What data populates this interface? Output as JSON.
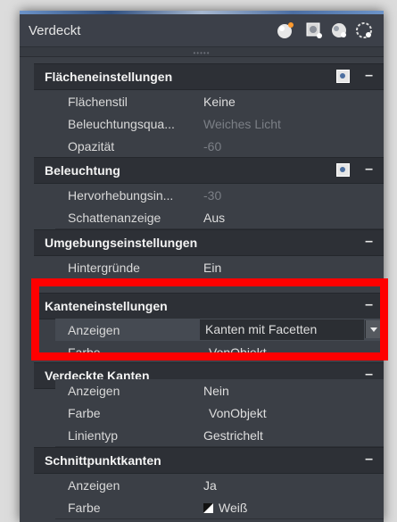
{
  "panel": {
    "title": "Verdeckt"
  },
  "toolbar_icons": [
    "sphere-render-icon",
    "materials-icon",
    "drop-icon",
    "refresh-icon"
  ],
  "sections": {
    "flaechen": {
      "title": "Flächeneinstellungen",
      "collapse": "–",
      "rows": [
        {
          "label": "Flächenstil",
          "value": "Keine"
        },
        {
          "label": "Beleuchtungsqua...",
          "value": "Weiches Licht"
        },
        {
          "label": "Opazität",
          "value": "-60"
        }
      ]
    },
    "beleuchtung": {
      "title": "Beleuchtung",
      "collapse": "–",
      "rows": [
        {
          "label": "Hervorhebungsin...",
          "value": "-30"
        },
        {
          "label": "Schattenanzeige",
          "value": "Aus"
        }
      ]
    },
    "umgebung": {
      "title": "Umgebungseinstellungen",
      "collapse": "–",
      "rows": [
        {
          "label": "Hintergründe",
          "value": "Ein"
        }
      ]
    },
    "kanten": {
      "title": "Kanteneinstellungen",
      "collapse": "–",
      "rows": [
        {
          "label": "Anzeigen",
          "value": "Kanten mit Facetten"
        },
        {
          "label": "Farbe",
          "value": "VonObjekt"
        }
      ]
    },
    "verdeckt": {
      "title": "Verdeckte Kanten",
      "collapse": "–",
      "rows": [
        {
          "label": "Anzeigen",
          "value": "Nein"
        },
        {
          "label": "Farbe",
          "value": "VonObjekt"
        },
        {
          "label": "Linientyp",
          "value": "Gestrichelt"
        }
      ]
    },
    "schnitt": {
      "title": "Schnittpunktkanten",
      "collapse": "–",
      "rows": [
        {
          "label": "Anzeigen",
          "value": "Ja"
        },
        {
          "label": "Farbe",
          "value": "Weiß"
        }
      ]
    }
  },
  "colors": {
    "panel_bg": "#3b3f46",
    "header_bg": "#2d3036",
    "highlight": "#ff0000"
  }
}
